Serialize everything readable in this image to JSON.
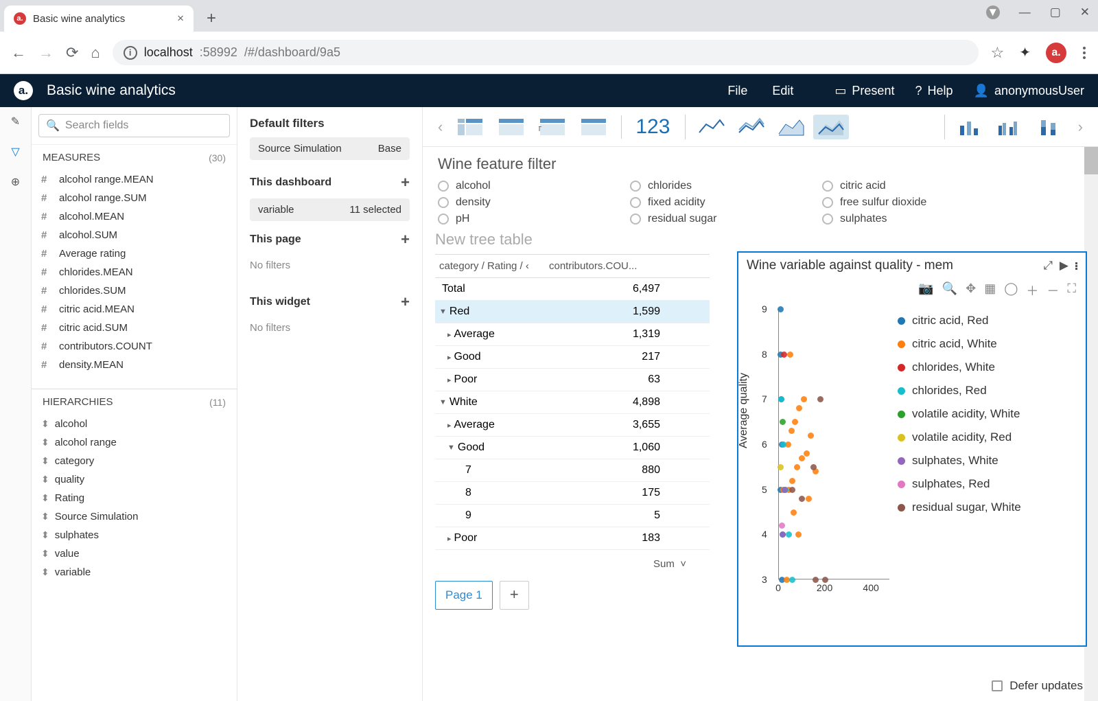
{
  "browser": {
    "tab_title": "Basic wine analytics",
    "url_host": "localhost",
    "url_port": ":58992",
    "url_path": "/#/dashboard/9a5"
  },
  "app_header": {
    "logo_text": "a.",
    "title": "Basic wine analytics",
    "menu": {
      "file": "File",
      "edit": "Edit"
    },
    "present": "Present",
    "help": "Help",
    "user": "anonymousUser"
  },
  "search_placeholder": "Search fields",
  "measures_header": "MEASURES",
  "measures_count": "(30)",
  "measures": [
    "alcohol range.MEAN",
    "alcohol range.SUM",
    "alcohol.MEAN",
    "alcohol.SUM",
    "Average rating",
    "chlorides.MEAN",
    "chlorides.SUM",
    "citric acid.MEAN",
    "citric acid.SUM",
    "contributors.COUNT",
    "density.MEAN"
  ],
  "hierarchies_header": "HIERARCHIES",
  "hierarchies_count": "(11)",
  "hierarchies": [
    "alcohol",
    "alcohol range",
    "category",
    "quality",
    "Rating",
    "Source Simulation",
    "sulphates",
    "value",
    "variable"
  ],
  "filter_panel": {
    "default_title": "Default filters",
    "source_label": "Source Simulation",
    "source_value": "Base",
    "dash_title": "This dashboard",
    "dash_name": "variable",
    "dash_value": "11 selected",
    "page_title": "This page",
    "widget_title": "This widget",
    "no_filters": "No filters"
  },
  "viz_number_label": "123",
  "feature_filter": {
    "title": "Wine feature filter",
    "items": [
      [
        "alcohol",
        "chlorides",
        "citric acid"
      ],
      [
        "density",
        "fixed acidity",
        "free sulfur dioxide"
      ],
      [
        "pH",
        "residual sugar",
        "sulphates"
      ]
    ]
  },
  "tree_table": {
    "title": "New tree table",
    "col1": "category / Rating / ‹",
    "col2": "contributors.COU...",
    "rows": [
      {
        "label": "Total",
        "value": "6,497",
        "indent": 0,
        "arrow": ""
      },
      {
        "label": "Red",
        "value": "1,599",
        "indent": 0,
        "arrow": "▼",
        "sel": true
      },
      {
        "label": "Average",
        "value": "1,319",
        "indent": 1,
        "arrow": "▸"
      },
      {
        "label": "Good",
        "value": "217",
        "indent": 1,
        "arrow": "▸"
      },
      {
        "label": "Poor",
        "value": "63",
        "indent": 1,
        "arrow": "▸"
      },
      {
        "label": "White",
        "value": "4,898",
        "indent": 0,
        "arrow": "▼"
      },
      {
        "label": "Average",
        "value": "3,655",
        "indent": 1,
        "arrow": "▸"
      },
      {
        "label": "Good",
        "value": "1,060",
        "indent": 1,
        "arrow": "▼"
      },
      {
        "label": "7",
        "value": "880",
        "indent": 2,
        "arrow": ""
      },
      {
        "label": "8",
        "value": "175",
        "indent": 2,
        "arrow": ""
      },
      {
        "label": "9",
        "value": "5",
        "indent": 2,
        "arrow": ""
      },
      {
        "label": "Poor",
        "value": "183",
        "indent": 1,
        "arrow": "▸"
      }
    ],
    "footer": "Sum",
    "page_label": "Page 1"
  },
  "scatter": {
    "title": "Wine variable against quality - mem",
    "ylabel": "Average quality",
    "legend": [
      {
        "name": "citric acid, Red",
        "color": "#1f77b4"
      },
      {
        "name": "citric acid, White",
        "color": "#ff7f0e"
      },
      {
        "name": "chlorides, White",
        "color": "#d62728"
      },
      {
        "name": "chlorides, Red",
        "color": "#17becf"
      },
      {
        "name": "volatile acidity, White",
        "color": "#2ca02c"
      },
      {
        "name": "volatile acidity, Red",
        "color": "#dbc21a"
      },
      {
        "name": "sulphates, White",
        "color": "#9467bd"
      },
      {
        "name": "sulphates, Red",
        "color": "#e377c2"
      },
      {
        "name": "residual sugar, White",
        "color": "#8c564b"
      }
    ]
  },
  "defer_label": "Defer updates",
  "chart_data": {
    "type": "scatter",
    "title": "Wine variable against quality - mem",
    "xlabel": "",
    "ylabel": "Average quality",
    "xlim": [
      0,
      450
    ],
    "ylim": [
      3,
      9
    ],
    "xticks": [
      0,
      200,
      400
    ],
    "yticks": [
      3,
      4,
      5,
      6,
      7,
      8,
      9
    ],
    "series": [
      {
        "name": "citric acid, Red",
        "color": "#1f77b4",
        "points": [
          [
            10,
            9
          ],
          [
            8,
            8
          ],
          [
            12,
            7
          ],
          [
            15,
            6
          ],
          [
            10,
            5
          ],
          [
            18,
            4
          ],
          [
            14,
            3
          ]
        ]
      },
      {
        "name": "citric acid, White",
        "color": "#ff7f0e",
        "points": [
          [
            20,
            5
          ],
          [
            30,
            5
          ],
          [
            45,
            5
          ],
          [
            60,
            5.2
          ],
          [
            80,
            5.5
          ],
          [
            100,
            5.7
          ],
          [
            40,
            6
          ],
          [
            55,
            6.3
          ],
          [
            70,
            6.5
          ],
          [
            90,
            6.8
          ],
          [
            110,
            7
          ],
          [
            50,
            8
          ],
          [
            65,
            4.5
          ],
          [
            120,
            5.8
          ],
          [
            140,
            6.2
          ],
          [
            160,
            5.4
          ],
          [
            35,
            3
          ],
          [
            85,
            4
          ],
          [
            130,
            4.8
          ]
        ]
      },
      {
        "name": "chlorides, White",
        "color": "#d62728",
        "points": [
          [
            25,
            8
          ]
        ]
      },
      {
        "name": "chlorides, Red",
        "color": "#17becf",
        "points": [
          [
            12,
            7
          ],
          [
            22,
            6
          ],
          [
            30,
            5
          ],
          [
            60,
            3
          ],
          [
            45,
            4
          ]
        ]
      },
      {
        "name": "volatile acidity, White",
        "color": "#2ca02c",
        "points": [
          [
            18,
            6.5
          ]
        ]
      },
      {
        "name": "volatile acidity, Red",
        "color": "#dbc21a",
        "points": [
          [
            10,
            5.5
          ]
        ]
      },
      {
        "name": "sulphates, White",
        "color": "#9467bd",
        "points": [
          [
            18,
            4
          ],
          [
            26,
            5
          ]
        ]
      },
      {
        "name": "sulphates, Red",
        "color": "#e377c2",
        "points": [
          [
            14,
            4.2
          ]
        ]
      },
      {
        "name": "residual sugar, White",
        "color": "#8c564b",
        "points": [
          [
            180,
            7
          ],
          [
            60,
            5
          ],
          [
            100,
            4.8
          ],
          [
            160,
            3
          ],
          [
            200,
            3
          ],
          [
            150,
            5.5
          ]
        ]
      }
    ]
  }
}
